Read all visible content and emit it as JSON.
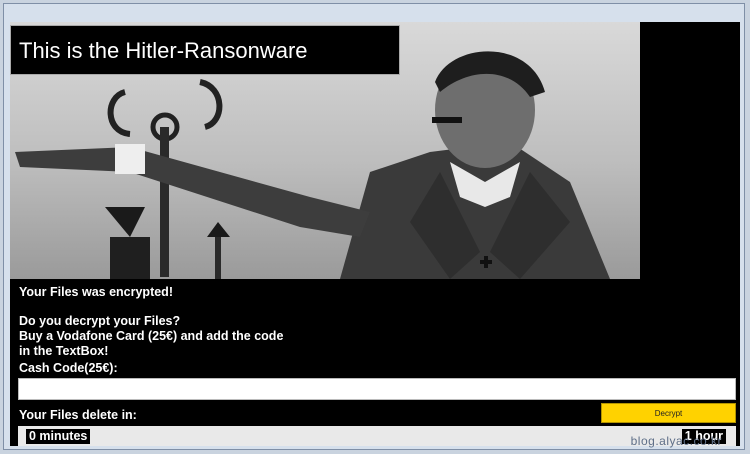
{
  "window": {
    "title": "This is the Hitler-Ransonware"
  },
  "message": {
    "line1": "Your Files was encrypted!",
    "line2": "Do you decrypt your Files?",
    "line3": "Buy a Vodafone Card (25€) and add the code",
    "line4": "in the TextBox!",
    "code_label": "Cash Code(25€):",
    "delete_label": "Your Files delete in:"
  },
  "input": {
    "value": "",
    "placeholder": ""
  },
  "buttons": {
    "decrypt": "Decrypt"
  },
  "timer": {
    "minutes": "0 minutes",
    "hours": "1 hour"
  },
  "watermark": "blog.alyac.co.kr",
  "colors": {
    "background": "#000000",
    "button": "#ffd200",
    "text": "#ffffff"
  }
}
